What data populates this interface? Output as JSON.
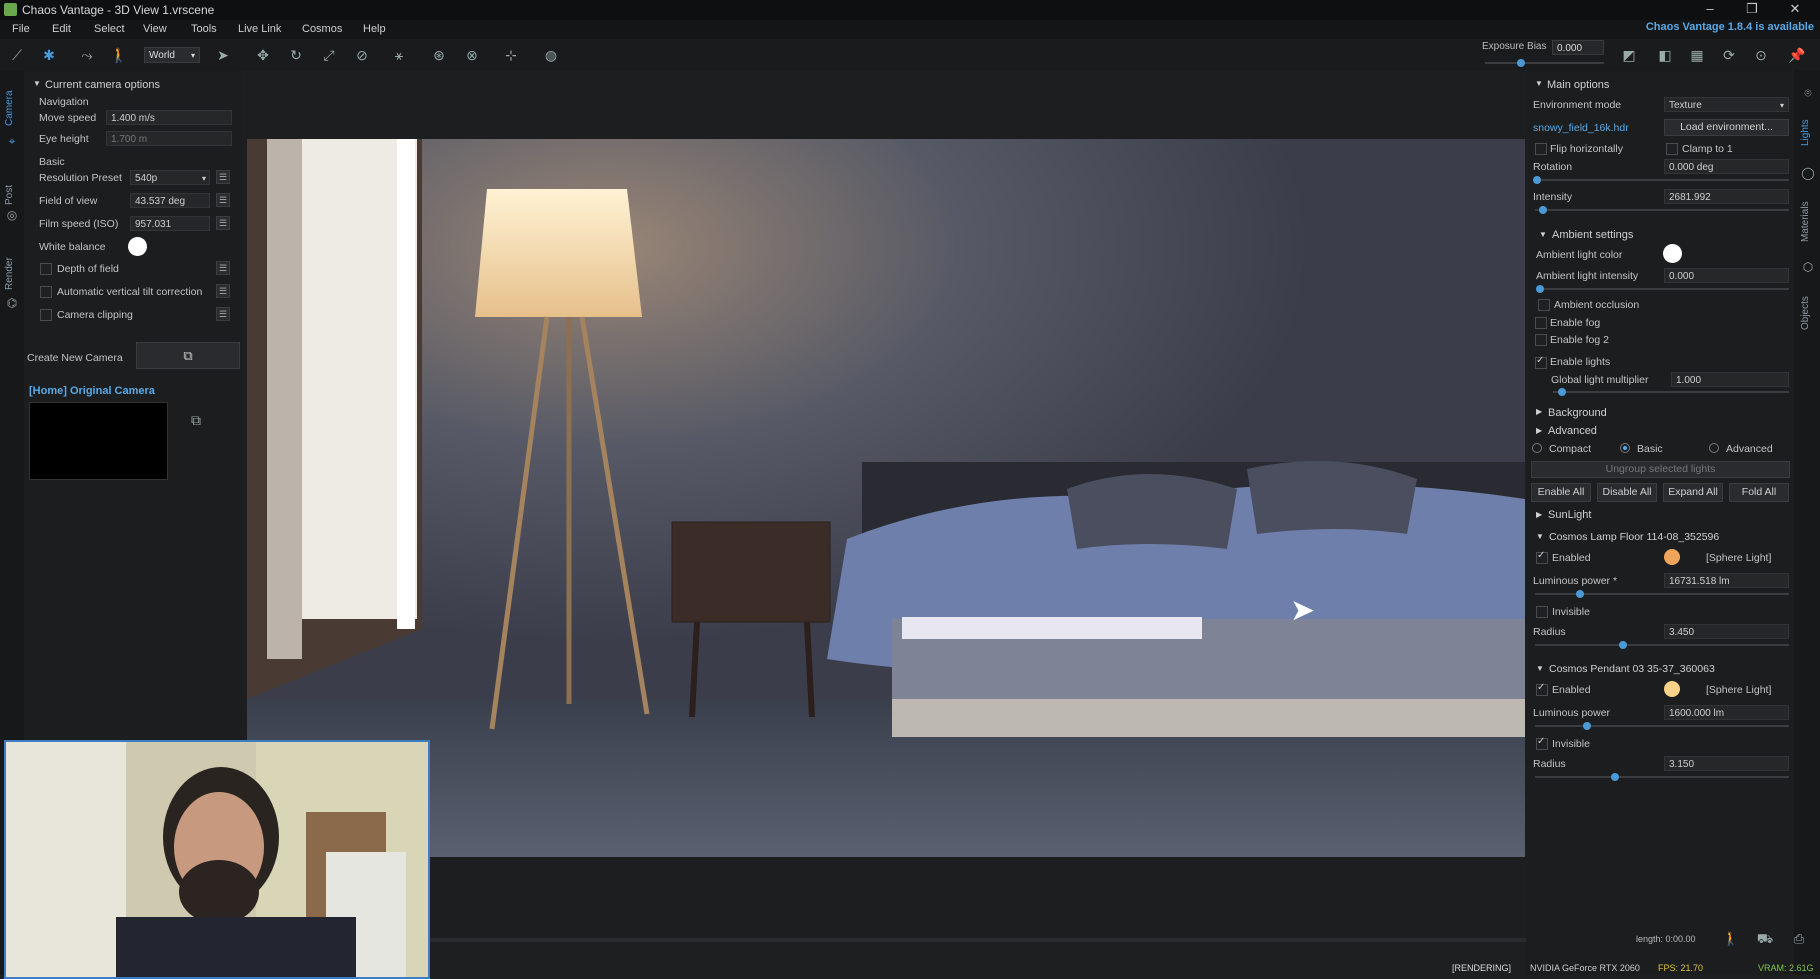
{
  "window": {
    "title": "Chaos Vantage - 3D View 1.vrscene",
    "minimize": "–",
    "maximize": "❐",
    "close": "✕",
    "update_notice": "Chaos Vantage 1.8.4 is available"
  },
  "menu": [
    "File",
    "Edit",
    "Select",
    "View",
    "Tools",
    "Live Link",
    "Cosmos",
    "Help"
  ],
  "toolbar": {
    "space_select": "World",
    "exposure_label": "Exposure Bias",
    "exposure_value": "0.000",
    "exposure_level": 0.06
  },
  "left_tabs": [
    "Camera",
    "Post",
    "Render"
  ],
  "right_tabs": [
    "Lights",
    "Materials",
    "Objects"
  ],
  "camera_panel": {
    "header": "Current camera options",
    "navigation_label": "Navigation",
    "move_speed_label": "Move speed",
    "move_speed": "1.400 m/s",
    "eye_height_label": "Eye height",
    "eye_height": "1.700 m",
    "basic_label": "Basic",
    "resolution_label": "Resolution Preset",
    "resolution": "540p",
    "fov_label": "Field of view",
    "fov": "43.537 deg",
    "iso_label": "Film speed (ISO)",
    "iso": "957.031",
    "wb_label": "White balance",
    "dof_label": "Depth of field",
    "tilt_label": "Automatic vertical tilt correction",
    "clipping_label": "Camera clipping",
    "create_camera_label": "Create New Camera",
    "original_camera": "[Home] Original Camera"
  },
  "lights_panel": {
    "main_options": "Main options",
    "env_mode_label": "Environment mode",
    "env_mode": "Texture",
    "hdr_file": "snowy_field_16k.hdr",
    "load_env": "Load environment...",
    "flip_label": "Flip horizontally",
    "clamp_label": "Clamp to 1",
    "rotation_label": "Rotation",
    "rotation": "0.000 deg",
    "intensity_label": "Intensity",
    "intensity": "2681.992",
    "ambient_settings": "Ambient settings",
    "ambient_color_label": "Ambient light color",
    "ambient_intensity_label": "Ambient light intensity",
    "ambient_intensity": "0.000",
    "ambient_occlusion": "Ambient occlusion",
    "fog": "Enable fog",
    "fog2": "Enable fog 2",
    "enable_lights": "Enable lights",
    "global_mult_label": "Global light multiplier",
    "global_mult": "1.000",
    "background": "Background",
    "advanced": "Advanced",
    "view_modes": [
      "Compact",
      "Basic",
      "Advanced"
    ],
    "view_mode_selected": "Basic",
    "ungroup": "Ungroup selected lights",
    "actions": [
      "Enable All",
      "Disable All",
      "Expand All",
      "Fold All"
    ],
    "sunlight": "SunLight",
    "lights": [
      {
        "name": "Cosmos Lamp Floor 114-08_352596",
        "enabled_label": "Enabled",
        "type": "[Sphere Light]",
        "color": "#f0a55a",
        "power_label": "Luminous power *",
        "power": "16731.518 lm",
        "invisible_label": "Invisible",
        "invisible": false,
        "radius_label": "Radius",
        "radius": "3.450"
      },
      {
        "name": "Cosmos Pendant 03 35-37_360063",
        "enabled_label": "Enabled",
        "type": "[Sphere Light]",
        "color": "#f7d38a",
        "power_label": "Luminous power",
        "power": "1600.000 lm",
        "invisible_label": "Invisible",
        "invisible": true,
        "radius_label": "Radius",
        "radius": "3.150"
      }
    ]
  },
  "status": {
    "length": "length: 0:00.00",
    "rendering": "[RENDERING]",
    "gpu": "NVIDIA GeForce RTX 2060",
    "fps": "FPS: 21.70",
    "vram": "VRAM: 2.61G"
  }
}
